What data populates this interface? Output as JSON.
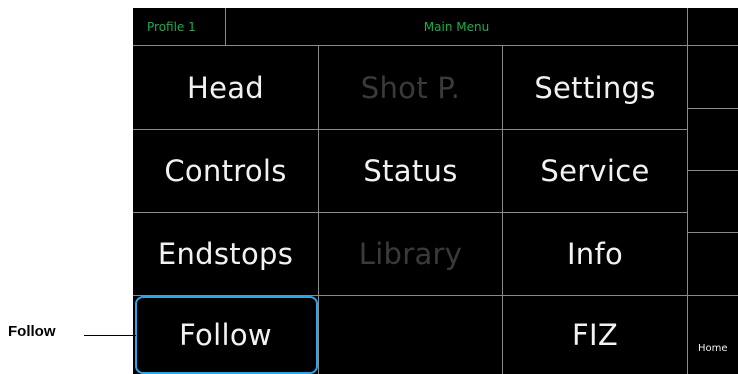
{
  "topbar": {
    "profile_label": "Profile 1",
    "title": "Main Menu"
  },
  "menu": {
    "rows": [
      [
        {
          "label": "Head",
          "enabled": true
        },
        {
          "label": "Shot P.",
          "enabled": false
        },
        {
          "label": "Settings",
          "enabled": true
        }
      ],
      [
        {
          "label": "Controls",
          "enabled": true
        },
        {
          "label": "Status",
          "enabled": true
        },
        {
          "label": "Service",
          "enabled": true
        }
      ],
      [
        {
          "label": "Endstops",
          "enabled": true
        },
        {
          "label": "Library",
          "enabled": false
        },
        {
          "label": "Info",
          "enabled": true
        }
      ],
      [
        {
          "label": "Follow",
          "enabled": true,
          "selected": true
        },
        {
          "label": "",
          "enabled": false
        },
        {
          "label": "FIZ",
          "enabled": true
        }
      ]
    ]
  },
  "sidebar": {
    "home_label": "Home"
  },
  "callout": {
    "label": "Follow"
  },
  "colors": {
    "topbar_text": "#14b24a",
    "selection_border": "#2aa6e8",
    "disabled_text": "#3a3a3a",
    "text": "#f2f2f2",
    "background": "#000000"
  }
}
